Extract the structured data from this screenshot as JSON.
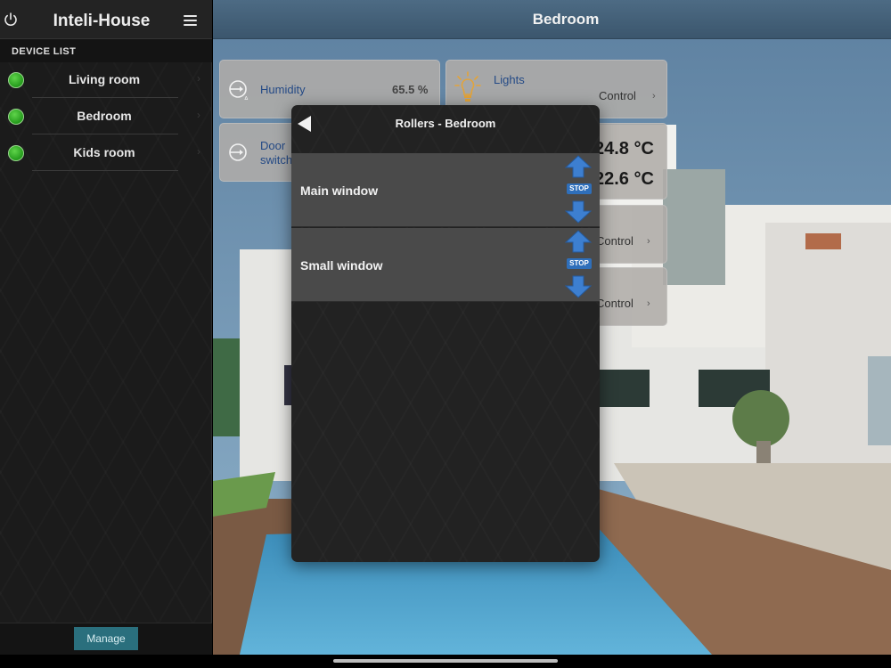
{
  "sidebar": {
    "app_title": "Inteli-House",
    "section_heading": "DEVICE LIST",
    "devices": [
      {
        "label": "Living room"
      },
      {
        "label": "Bedroom"
      },
      {
        "label": "Kids room"
      }
    ],
    "chevron": "›",
    "manage_label": "Manage"
  },
  "main": {
    "title": "Bedroom",
    "tiles": {
      "humidity": {
        "label": "Humidity",
        "value": "65.5 %"
      },
      "lights": {
        "label": "Lights",
        "control": "Control",
        "chevron": "›"
      },
      "door": {
        "label_line1": "Door",
        "label_line2": "switch"
      },
      "temps": {
        "value1": "24.8 °C",
        "value2": "22.6 °C"
      },
      "control3": {
        "control": "Control",
        "chevron": "›"
      },
      "control4": {
        "control": "Control",
        "chevron": "›"
      }
    }
  },
  "modal": {
    "title": "Rollers - Bedroom",
    "rollers": [
      {
        "label": "Main window",
        "stop": "STOP"
      },
      {
        "label": "Small window",
        "stop": "STOP"
      }
    ]
  },
  "colors": {
    "accent_blue": "#2f6fba",
    "status_green": "#249a1c",
    "manage_button": "#2a6f7d"
  },
  "icons": {
    "power": "power-icon",
    "menu": "hamburger-menu-icon",
    "status": "status-dot-icon",
    "back": "back-triangle-icon",
    "up": "arrow-up-icon",
    "down": "arrow-down-icon",
    "bulb": "lightbulb-icon",
    "sensor": "sensor-icon"
  }
}
